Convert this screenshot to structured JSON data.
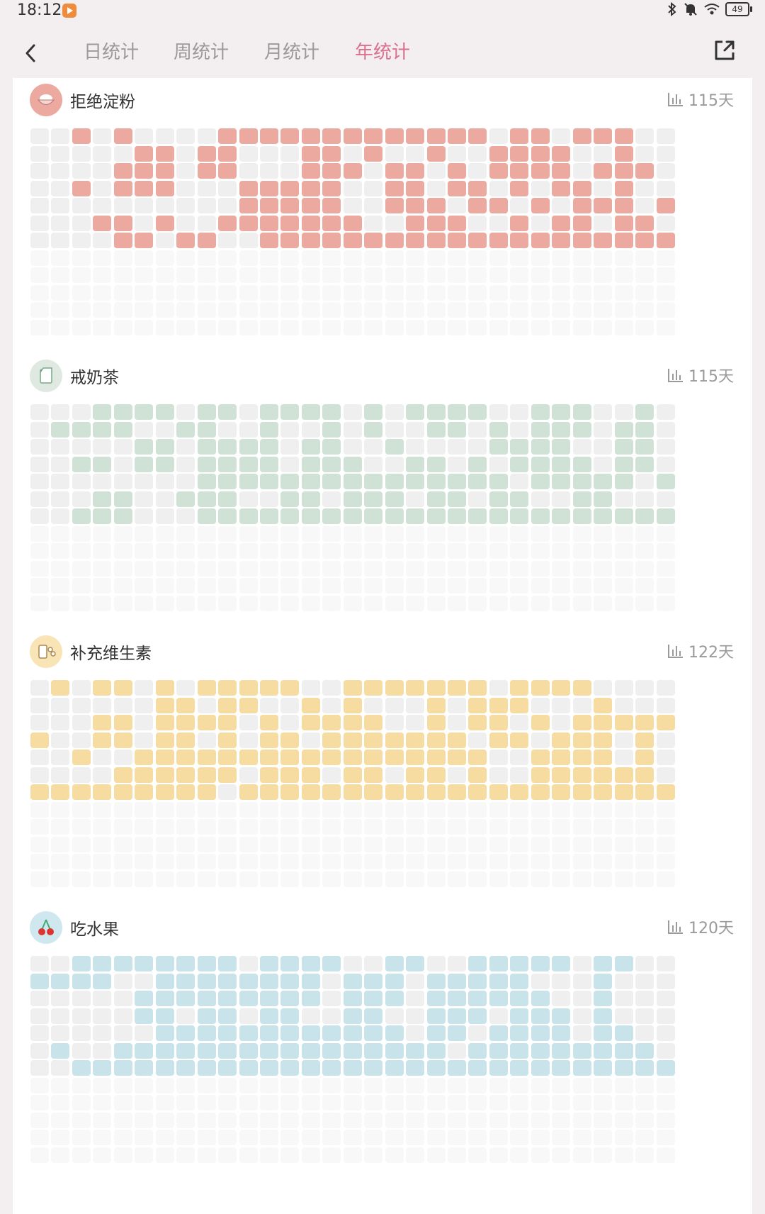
{
  "status_bar": {
    "time": "18:12",
    "battery": "49"
  },
  "nav": {
    "tabs": [
      {
        "label": "日统计",
        "active": false
      },
      {
        "label": "周统计",
        "active": false
      },
      {
        "label": "月统计",
        "active": false
      },
      {
        "label": "年统计",
        "active": true
      }
    ]
  },
  "colors": {
    "background": "#f3eeef",
    "accent_tab": "#d9708d",
    "cell_empty": "#efefef",
    "cell_future": "#f8f8f8"
  },
  "sections": [
    {
      "title": "拒绝淀粉",
      "count": "115天",
      "icon": "rice-bowl-icon",
      "color": "#eba99f",
      "icon_bg": "#eba99f",
      "grid": [
        "0010100001111111111111011011100",
        "0000011011000110100100111100100",
        "0000111011000111011010111101110",
        "0010111000111110011011010110100",
        "0000000000111110011101101011101",
        "0001101001111111001110010110110",
        "0000110110011111111111111111111"
      ]
    },
    {
      "title": "戒奶茶",
      "count": "115天",
      "icon": "milk-carton-icon",
      "color": "#cfe2d5",
      "icon_bg": "#dfe9e2",
      "grid": [
        "0001111011011110101111001110010",
        "0111100110010010100110101110110",
        "0000011011110110010000111100110",
        "0011011011110111001101011110110",
        "0000000011111111111111101111101",
        "0001100111001101110110110011000",
        "0011100011111111111111111111111"
      ]
    },
    {
      "title": "补充维生素",
      "count": "122天",
      "icon": "vitamin-bottle-icon",
      "color": "#f7dca2",
      "icon_bg": "#f9e4b5",
      "grid": [
        "0101101011111001111111011110000",
        "0000001101100101000101110001000",
        "0001101111010111100101101011111",
        "1001101101011011111110110111010",
        "0010011111111111111111001111010",
        "0000111111011101101101001111110",
        "1111111110111111111111111111111"
      ]
    },
    {
      "title": "吃水果",
      "count": "120天",
      "icon": "cherry-icon",
      "color": "#c8e3ea",
      "icon_bg": "#cfe7ee",
      "grid": [
        "0011111111011110011001111101100",
        "1111001111111101110111110001000",
        "0000011111111101110111111001000",
        "0000011011011001100111011101000",
        "0000001111111111110110111101100",
        "0100111111111111111101111111110",
        "0011111111111111111111111111111"
      ]
    }
  ]
}
